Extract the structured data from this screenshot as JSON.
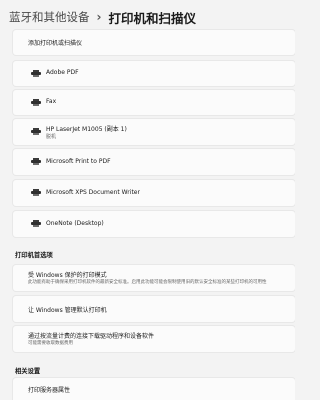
{
  "breadcrumb": {
    "parent": "蓝牙和其他设备",
    "separator": "›",
    "current": "打印机和扫描仪"
  },
  "add_printer": {
    "label": "添加打印机或扫描仪"
  },
  "printers": [
    {
      "name": "Adobe PDF",
      "status": "",
      "icon": "printer-icon"
    },
    {
      "name": "Fax",
      "status": "",
      "icon": "fax-printer-icon"
    },
    {
      "name": "HP LaserJet M1005 (副本 1)",
      "status": "脱机",
      "icon": "printer-icon"
    },
    {
      "name": "Microsoft Print to PDF",
      "status": "",
      "icon": "printer-icon"
    },
    {
      "name": "Microsoft XPS Document Writer",
      "status": "",
      "icon": "printer-icon"
    },
    {
      "name": "OneNote (Desktop)",
      "status": "",
      "icon": "printer-icon"
    }
  ],
  "printer_preferences": {
    "title": "打印机首选项",
    "items": [
      {
        "title": "受 Windows 保护的打印模式",
        "desc": "此功能有助于确保采用打印机软件的最新安全标准。启用此功能可能会限制使用旧的默认安全标准的某些打印机的可用性"
      },
      {
        "title": "让 Windows 管理默认打印机",
        "desc": ""
      },
      {
        "title": "通过按流量计费的连接下载驱动程序和设备软件",
        "desc": "可能需要收取数据费用"
      }
    ]
  },
  "related_settings": {
    "title": "相关设置",
    "items": [
      {
        "title": "打印服务器属性"
      }
    ]
  }
}
